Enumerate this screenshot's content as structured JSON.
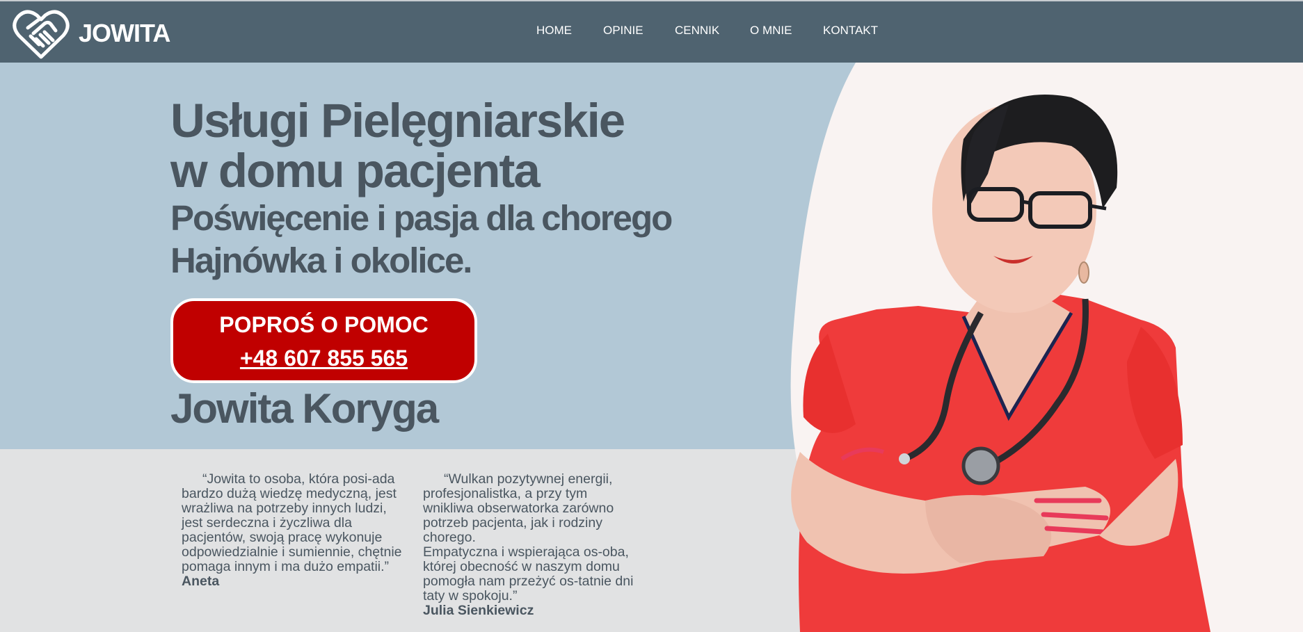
{
  "header": {
    "brand": "JOWITA",
    "nav": [
      "HOME",
      "OPINIE",
      "CENNIK",
      "O MNIE",
      "KONTAKT"
    ]
  },
  "hero": {
    "title_line1": "Usługi Pielęgniarskie",
    "title_line2": "w domu pacjenta",
    "subtitle_line1": "Poświęcenie i pasja dla chorego",
    "subtitle_line2": "Hajnówka i okolice.",
    "cta_label": "POPROŚ O POMOC",
    "cta_phone": "+48 607 855 565",
    "name": "Jowita Koryga"
  },
  "testimonials": [
    {
      "paragraphs": [
        "“Jowita to osoba, która posi-ada bardzo dużą wiedzę medyczną, jest wrażliwa na potrzeby innych ludzi, jest serdeczna i życzliwa dla pacjentów, swoją pracę wykonuje odpowiedzialnie i sumiennie, chętnie pomaga innym i ma dużo empatii.”"
      ],
      "author": "Aneta"
    },
    {
      "paragraphs": [
        "“Wulkan pozytywnej energii, profesjonalistka, a przy tym wnikliwa obserwatorka zarówno potrzeb pacjenta, jak i rodziny chorego.",
        "Empatyczna i wspierająca os-oba, której obecność w naszym domu pomogła nam przeżyć os-tatnie dni taty w spokoju.”"
      ],
      "author": "Julia Sienkiewicz"
    }
  ],
  "colors": {
    "navbar": "#4f6370",
    "hero_bg": "#b2c8d6",
    "lower_bg": "#e1e2e3",
    "cta": "#c00000",
    "text": "#4a5660",
    "scrubs": "#ef3b3b"
  },
  "icons": {
    "logo": "heart-handshake-icon"
  }
}
